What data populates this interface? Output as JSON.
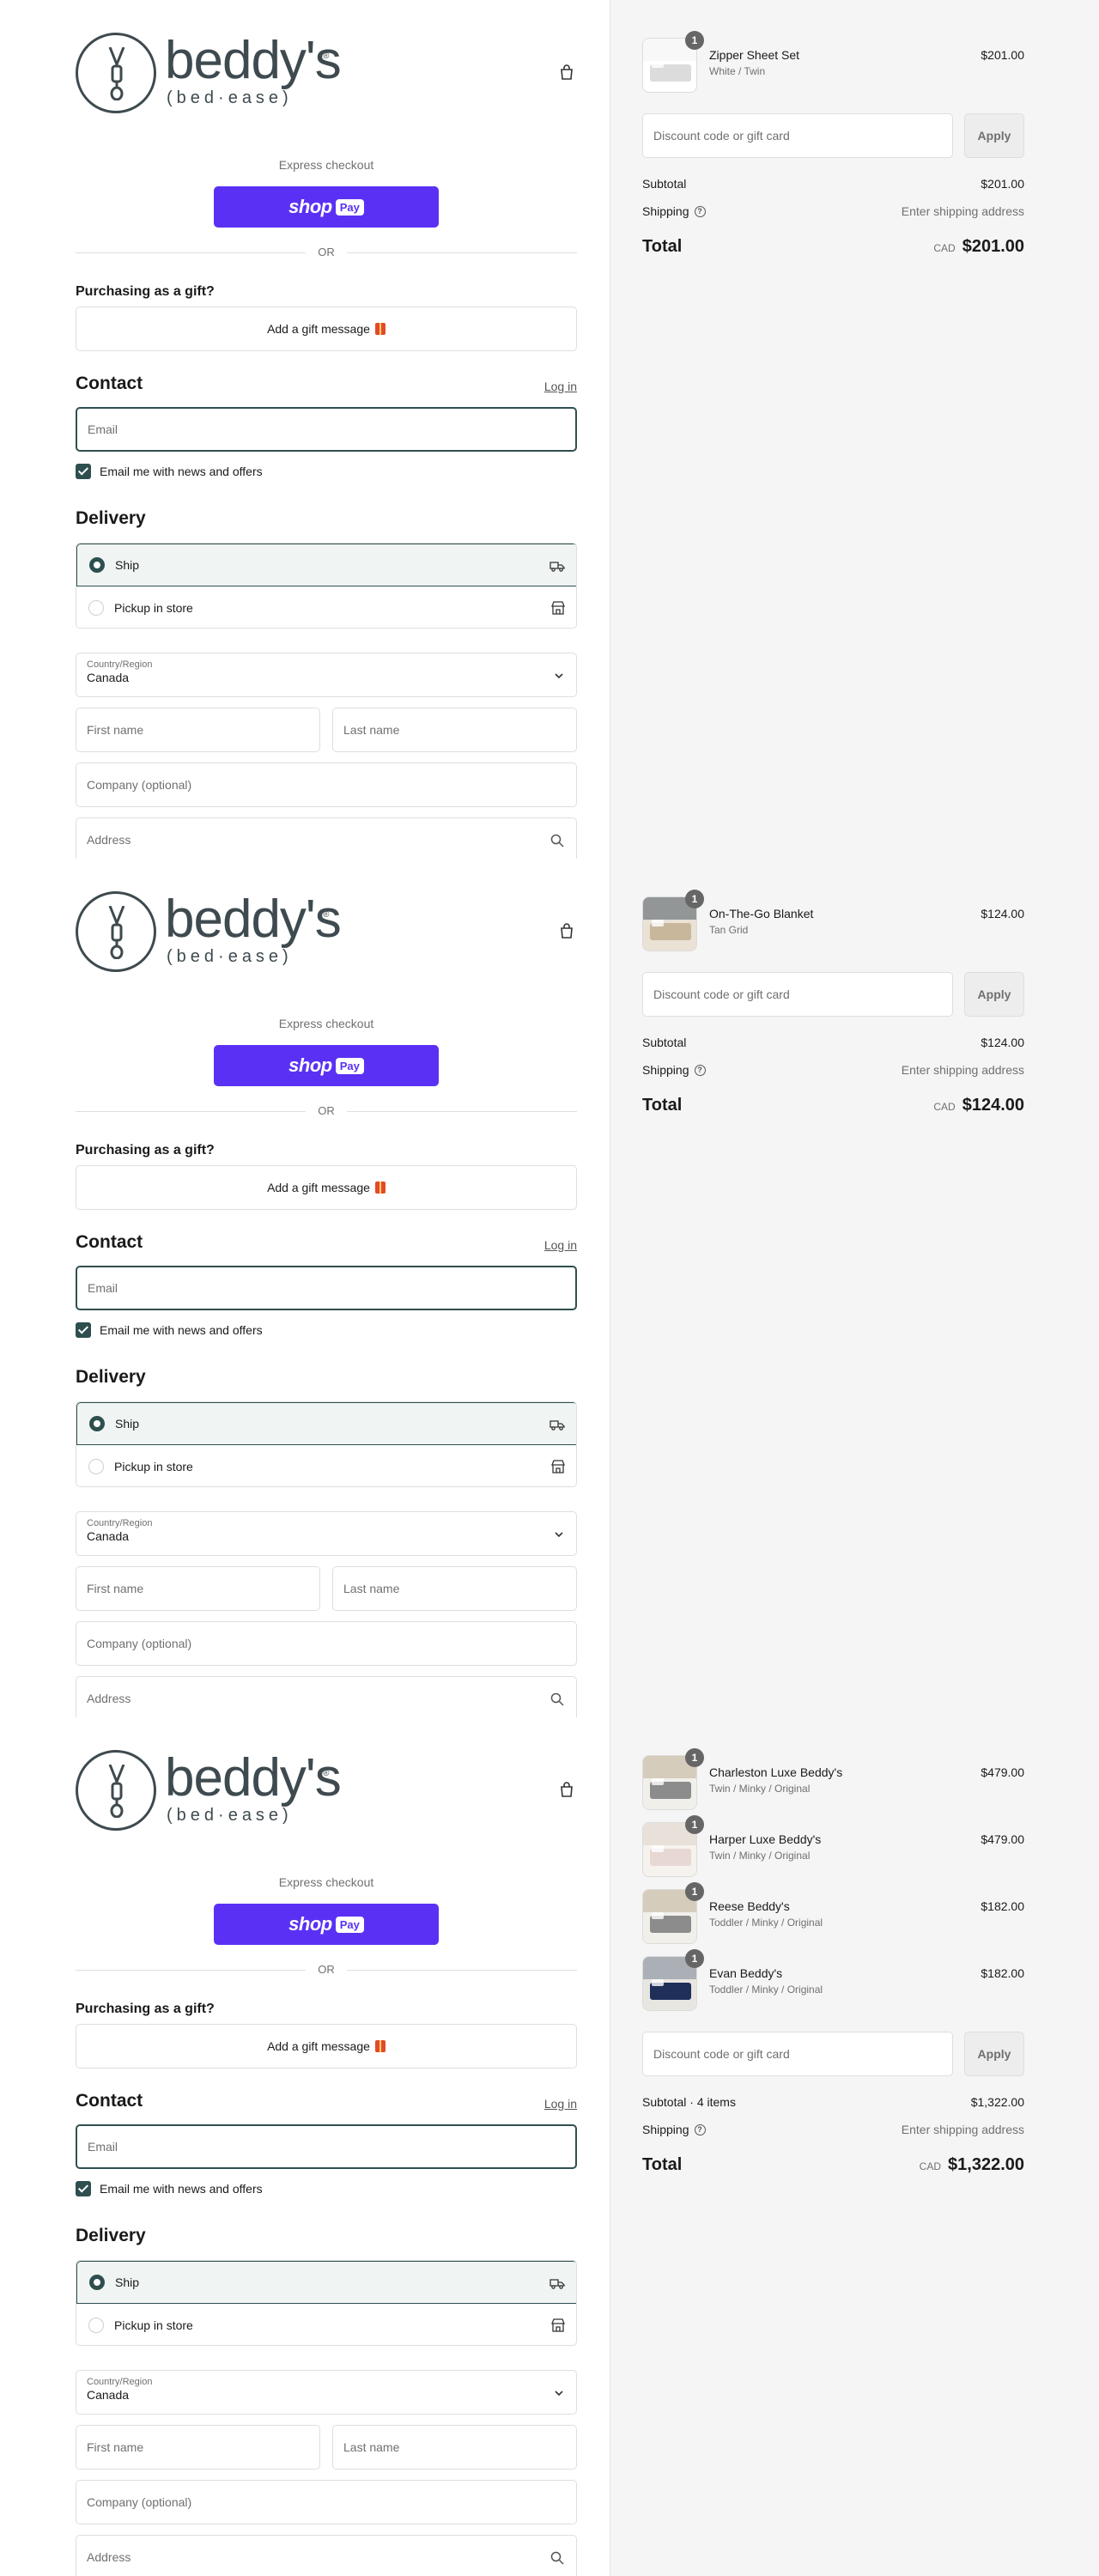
{
  "colors": {
    "accent": "#2f4f4f",
    "shop_pay": "#5a31f4",
    "sidebar_bg": "#f5f5f5"
  },
  "panels": [
    {
      "brand": {
        "word": "beddy's",
        "reg": "®",
        "tagline": "(bed·ease)"
      },
      "express_label": "Express checkout",
      "shoppay": {
        "word": "shop",
        "pay": "Pay"
      },
      "or_label": "OR",
      "gift": {
        "title": "Purchasing as a gift?",
        "button": "Add a gift message"
      },
      "contact": {
        "title": "Contact",
        "login": "Log in",
        "email_placeholder": "Email",
        "news_label": "Email me with news and offers",
        "news_checked": true
      },
      "delivery": {
        "title": "Delivery",
        "ship": "Ship",
        "pickup": "Pickup in store",
        "selected": "ship"
      },
      "country": {
        "label": "Country/Region",
        "value": "Canada"
      },
      "placeholders": {
        "first": "First name",
        "last": "Last name",
        "company": "Company (optional)",
        "address": "Address"
      },
      "items": [
        {
          "qty": "1",
          "name": "Zipper Sheet Set",
          "variant": "White / Twin",
          "price": "$201.00",
          "thumb": "sheets"
        }
      ],
      "discount_placeholder": "Discount code or gift card",
      "apply": "Apply",
      "subtotal_label": "Subtotal",
      "subtotal": "$201.00",
      "shipping_label": "Shipping",
      "shipping_value": "Enter shipping address",
      "total_label": "Total",
      "currency": "CAD",
      "total": "$201.00"
    },
    {
      "brand": {
        "word": "beddy's",
        "reg": "®",
        "tagline": "(bed·ease)"
      },
      "express_label": "Express checkout",
      "shoppay": {
        "word": "shop",
        "pay": "Pay"
      },
      "or_label": "OR",
      "gift": {
        "title": "Purchasing as a gift?",
        "button": "Add a gift message"
      },
      "contact": {
        "title": "Contact",
        "login": "Log in",
        "email_placeholder": "Email",
        "news_label": "Email me with news and offers",
        "news_checked": true
      },
      "delivery": {
        "title": "Delivery",
        "ship": "Ship",
        "pickup": "Pickup in store",
        "selected": "ship"
      },
      "country": {
        "label": "Country/Region",
        "value": "Canada"
      },
      "placeholders": {
        "first": "First name",
        "last": "Last name",
        "company": "Company (optional)",
        "address": "Address"
      },
      "items": [
        {
          "qty": "1",
          "name": "On-The-Go Blanket",
          "variant": "Tan Grid",
          "price": "$124.00",
          "thumb": "blanket"
        }
      ],
      "discount_placeholder": "Discount code or gift card",
      "apply": "Apply",
      "subtotal_label": "Subtotal",
      "subtotal": "$124.00",
      "shipping_label": "Shipping",
      "shipping_value": "Enter shipping address",
      "total_label": "Total",
      "currency": "CAD",
      "total": "$124.00"
    },
    {
      "brand": {
        "word": "beddy's",
        "reg": "®",
        "tagline": "(bed·ease)"
      },
      "express_label": "Express checkout",
      "shoppay": {
        "word": "shop",
        "pay": "Pay"
      },
      "or_label": "OR",
      "gift": {
        "title": "Purchasing as a gift?",
        "button": "Add a gift message"
      },
      "contact": {
        "title": "Contact",
        "login": "Log in",
        "email_placeholder": "Email",
        "news_label": "Email me with news and offers",
        "news_checked": true
      },
      "delivery": {
        "title": "Delivery",
        "ship": "Ship",
        "pickup": "Pickup in store",
        "selected": "ship"
      },
      "country": {
        "label": "Country/Region",
        "value": "Canada"
      },
      "placeholders": {
        "first": "First name",
        "last": "Last name",
        "company": "Company (optional)",
        "address": "Address"
      },
      "items": [
        {
          "qty": "1",
          "name": "Charleston Luxe Beddy's",
          "variant": "Twin / Minky / Original",
          "price": "$479.00",
          "thumb": "bed-gray"
        },
        {
          "qty": "1",
          "name": "Harper Luxe Beddy's",
          "variant": "Twin / Minky / Original",
          "price": "$479.00",
          "thumb": "bed-pink"
        },
        {
          "qty": "1",
          "name": "Reese Beddy's",
          "variant": "Toddler / Minky / Original",
          "price": "$182.00",
          "thumb": "bed-gray"
        },
        {
          "qty": "1",
          "name": "Evan Beddy's",
          "variant": "Toddler / Minky / Original",
          "price": "$182.00",
          "thumb": "bed-navy"
        }
      ],
      "discount_placeholder": "Discount code or gift card",
      "apply": "Apply",
      "subtotal_label": "Subtotal · 4 items",
      "subtotal": "$1,322.00",
      "shipping_label": "Shipping",
      "shipping_value": "Enter shipping address",
      "total_label": "Total",
      "currency": "CAD",
      "total": "$1,322.00"
    }
  ]
}
